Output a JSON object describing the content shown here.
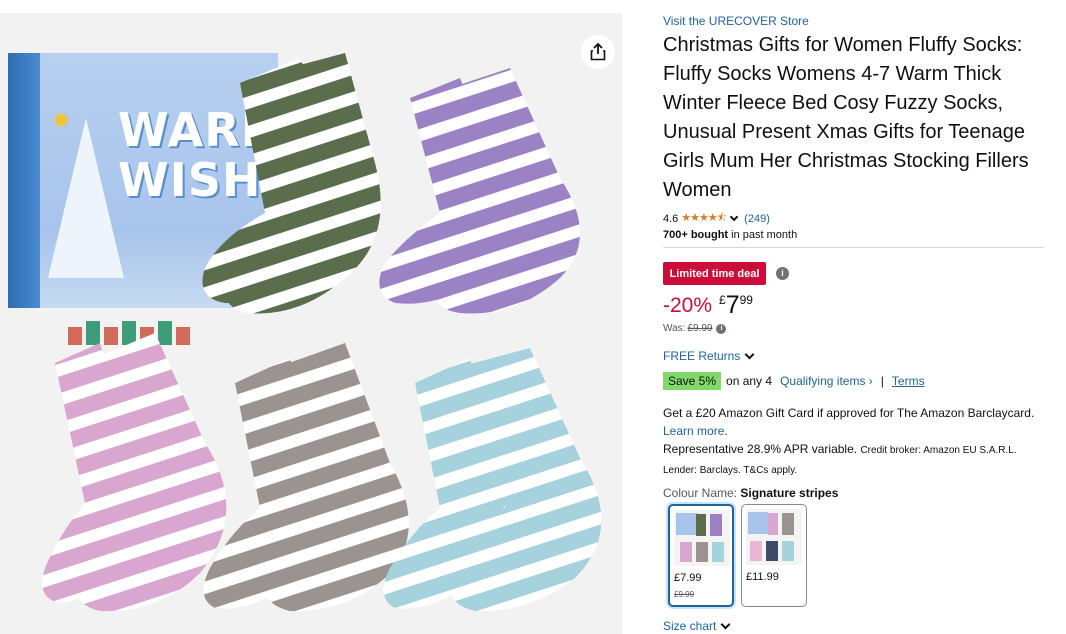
{
  "product": {
    "store_link": "Visit the URECOVER Store",
    "title": "Christmas Gifts for Women Fluffy Socks: Fluffy Socks Womens 4-7 Warm Thick Winter Fleece Bed Cosy Fuzzy Socks, Unusual Present Xmas Gifts for Teenage Girls Mum Her Christmas Stocking Fillers Women",
    "rating": "4.6",
    "stars": "★★★★⯪",
    "rating_count": "(249)",
    "bought_bold": "700+ bought",
    "bought_rest": "in past month"
  },
  "image": {
    "box_text_line1": "WARM",
    "box_text_line2": "WISHES",
    "share_icon": "share-icon"
  },
  "deal": {
    "badge": "Limited time deal",
    "discount": "-20%",
    "currency": "£",
    "price_whole": "7",
    "price_fraction": "99",
    "was_label": "Was:",
    "was_price": "£9.99"
  },
  "returns": {
    "label": "FREE Returns"
  },
  "savings": {
    "badge": "Save 5%",
    "text": "on any 4",
    "qualifying": "Qualifying items ›",
    "separator": "|",
    "terms": "Terms"
  },
  "gift_card": {
    "text": "Get a £20 Amazon Gift Card if approved for The Amazon Barclaycard.",
    "link": "Learn more",
    "period": "."
  },
  "apr": {
    "main": "Representative 28.9% APR variable.",
    "small": "Credit broker: Amazon EU S.A.R.L. Lender: Barclays. T&Cs apply."
  },
  "colour": {
    "label": "Colour Name:",
    "selected": "Signature stripes",
    "swatches": [
      {
        "price": "£7.99",
        "was": "£9.99"
      },
      {
        "price": "£11.99"
      }
    ]
  },
  "size_chart": {
    "label": "Size chart"
  },
  "colors": {
    "link": "#2162a1",
    "deal_red": "#cc0c39",
    "save_green": "#7fda69",
    "star_orange": "#de7921",
    "sock_green": "#5a6e4e",
    "sock_purple": "#9b82c4",
    "sock_pink": "#d8a6cf",
    "sock_grey": "#9a9390",
    "sock_blue": "#a5d2dc"
  }
}
